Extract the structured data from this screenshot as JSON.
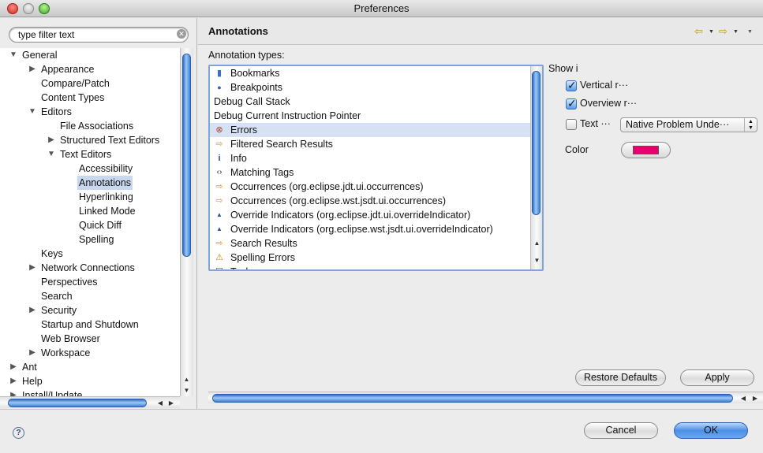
{
  "window": {
    "title": "Preferences"
  },
  "filter": {
    "placeholder": "type filter text"
  },
  "tree": [
    {
      "label": "General",
      "twisty": "▼"
    },
    {
      "label": "Appearance",
      "twisty": "▶"
    },
    {
      "label": "Compare/Patch",
      "twisty": ""
    },
    {
      "label": "Content Types",
      "twisty": ""
    },
    {
      "label": "Editors",
      "twisty": "▼"
    },
    {
      "label": "File Associations",
      "twisty": ""
    },
    {
      "label": "Structured Text Editors",
      "twisty": "▶"
    },
    {
      "label": "Text Editors",
      "twisty": "▼"
    },
    {
      "label": "Accessibility",
      "twisty": ""
    },
    {
      "label": "Annotations",
      "twisty": "",
      "selected": true
    },
    {
      "label": "Hyperlinking",
      "twisty": ""
    },
    {
      "label": "Linked Mode",
      "twisty": ""
    },
    {
      "label": "Quick Diff",
      "twisty": ""
    },
    {
      "label": "Spelling",
      "twisty": ""
    },
    {
      "label": "Keys",
      "twisty": ""
    },
    {
      "label": "Network Connections",
      "twisty": "▶"
    },
    {
      "label": "Perspectives",
      "twisty": ""
    },
    {
      "label": "Search",
      "twisty": ""
    },
    {
      "label": "Security",
      "twisty": "▶"
    },
    {
      "label": "Startup and Shutdown",
      "twisty": ""
    },
    {
      "label": "Web Browser",
      "twisty": ""
    },
    {
      "label": "Workspace",
      "twisty": "▶"
    },
    {
      "label": "Ant",
      "twisty": "▶"
    },
    {
      "label": "Help",
      "twisty": "▶"
    },
    {
      "label": "Install/Update",
      "twisty": "▶"
    }
  ],
  "page": {
    "title": "Annotations",
    "types_label": "Annotation types:",
    "annotation_types": [
      {
        "label": "Bookmarks",
        "icon": "bookmark-icon"
      },
      {
        "label": "Breakpoints",
        "icon": "breakpoint-icon"
      },
      {
        "label": "Debug Call Stack",
        "icon": ""
      },
      {
        "label": "Debug Current Instruction Pointer",
        "icon": ""
      },
      {
        "label": "Errors",
        "icon": "error-icon",
        "selected": true
      },
      {
        "label": "Filtered Search Results",
        "icon": "arrow-icon"
      },
      {
        "label": "Info",
        "icon": "info-icon"
      },
      {
        "label": "Matching Tags",
        "icon": "tag-icon"
      },
      {
        "label": "Occurrences (org.eclipse.jdt.ui.occurrences)",
        "icon": "arrow-icon"
      },
      {
        "label": "Occurrences (org.eclipse.wst.jsdt.ui.occurrences)",
        "icon": "arrow-icon"
      },
      {
        "label": "Override Indicators (org.eclipse.jdt.ui.overrideIndicator)",
        "icon": "override-icon"
      },
      {
        "label": "Override Indicators (org.eclipse.wst.jsdt.ui.overrideIndicator)",
        "icon": "override-icon"
      },
      {
        "label": "Search Results",
        "icon": "arrow-icon"
      },
      {
        "label": "Spelling Errors",
        "icon": "warning-icon"
      },
      {
        "label": "Tasks",
        "icon": "task-icon"
      }
    ],
    "show_in": "Show i",
    "vertical_ruler": {
      "label": "Vertical r···",
      "checked": true
    },
    "overview_ruler": {
      "label": "Overview r···",
      "checked": true
    },
    "text": {
      "label": "Text ···",
      "checked": false
    },
    "text_style": "Native Problem Unde···",
    "color_label": "Color",
    "color_value": "#e8006e",
    "restore_defaults": "Restore Defaults",
    "apply": "Apply"
  },
  "footer": {
    "cancel": "Cancel",
    "ok": "OK",
    "help": "?"
  }
}
